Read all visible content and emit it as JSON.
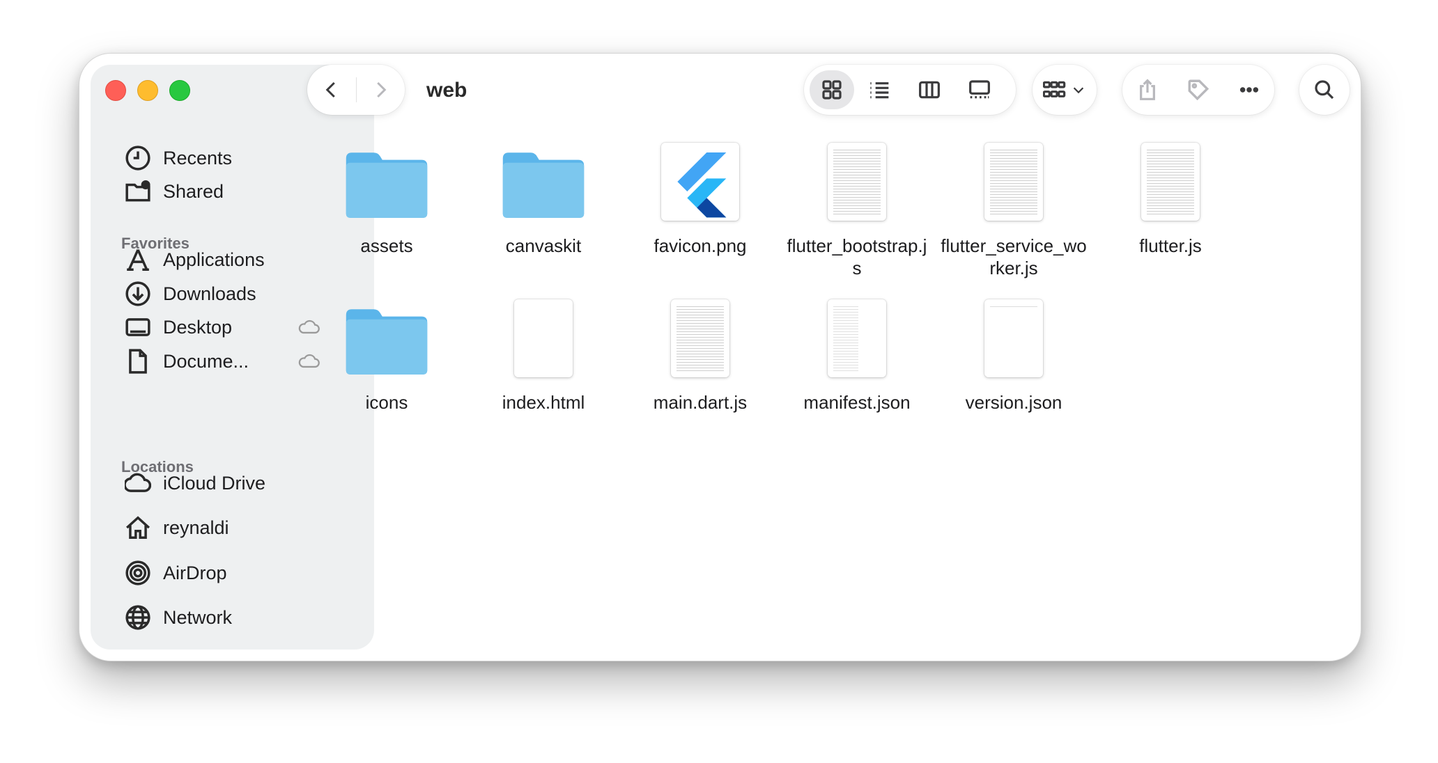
{
  "window": {
    "title": "web"
  },
  "sidebar": {
    "top_items": [
      {
        "label": "Recents",
        "icon": "clock-icon"
      },
      {
        "label": "Shared",
        "icon": "shared-folder-icon"
      }
    ],
    "favorites_header": "Favorites",
    "favorites": [
      {
        "label": "Applications",
        "icon": "applications-icon"
      },
      {
        "label": "Downloads",
        "icon": "download-icon"
      },
      {
        "label": "Desktop",
        "icon": "desktop-icon",
        "cloud": true
      },
      {
        "label": "Docume...",
        "icon": "document-icon",
        "cloud": true
      }
    ],
    "locations_header": "Locations",
    "locations": [
      {
        "label": "iCloud Drive",
        "icon": "cloud-icon"
      },
      {
        "label": "reynaldi",
        "icon": "home-icon"
      },
      {
        "label": "AirDrop",
        "icon": "airdrop-icon"
      },
      {
        "label": "Network",
        "icon": "globe-icon"
      }
    ]
  },
  "toolbar": {
    "views": [
      "icon-view",
      "list-view",
      "column-view",
      "gallery-view"
    ],
    "selected_view": "icon-view"
  },
  "files": [
    {
      "name": "assets",
      "kind": "folder"
    },
    {
      "name": "canvaskit",
      "kind": "folder"
    },
    {
      "name": "favicon.png",
      "kind": "image"
    },
    {
      "name": "flutter_bootstrap.js",
      "kind": "doc"
    },
    {
      "name": "flutter_service_worker.js",
      "kind": "doc"
    },
    {
      "name": "flutter.js",
      "kind": "doc"
    },
    {
      "name": "icons",
      "kind": "folder"
    },
    {
      "name": "index.html",
      "kind": "blank"
    },
    {
      "name": "main.dart.js",
      "kind": "doc"
    },
    {
      "name": "manifest.json",
      "kind": "doc-sparse"
    },
    {
      "name": "version.json",
      "kind": "doc-tiny"
    }
  ],
  "colors": {
    "folder_top": "#7cc7ee",
    "folder_body": "#5bb5ea",
    "close": "#fe5f57",
    "minimize": "#febc2e",
    "zoom": "#28c840"
  }
}
